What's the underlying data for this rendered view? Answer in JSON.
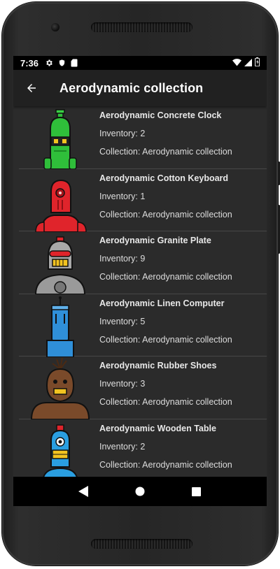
{
  "status_bar": {
    "time": "7:36",
    "icons": [
      "settings-icon",
      "shield-icon",
      "sd-card-icon"
    ],
    "right_icons": [
      "wifi-icon",
      "signal-icon",
      "battery-icon"
    ]
  },
  "app_bar": {
    "title": "Aerodynamic collection",
    "back_icon": "arrow-back-icon"
  },
  "items": [
    {
      "name": "Aerodynamic Concrete Clock",
      "inventory": "Inventory: 2",
      "collection": "Collection: Aerodynamic collection",
      "robot": "green robot",
      "color": "#2fbf3a"
    },
    {
      "name": "Aerodynamic Cotton Keyboard",
      "inventory": "Inventory: 1",
      "collection": "Collection: Aerodynamic collection",
      "robot": "red robot",
      "color": "#e0242b"
    },
    {
      "name": "Aerodynamic Granite Plate",
      "inventory": "Inventory: 9",
      "collection": "Collection: Aerodynamic collection",
      "robot": "grey robot",
      "color": "#9a9a9a"
    },
    {
      "name": "Aerodynamic Linen Computer",
      "inventory": "Inventory: 5",
      "collection": "Collection: Aerodynamic collection",
      "robot": "blue robot",
      "color": "#2f8fd8"
    },
    {
      "name": "Aerodynamic Rubber Shoes",
      "inventory": "Inventory: 3",
      "collection": "Collection: Aerodynamic collection",
      "robot": "brown robot",
      "color": "#7a4a2a"
    },
    {
      "name": "Aerodynamic Wooden Table",
      "inventory": "Inventory: 2",
      "collection": "Collection: Aerodynamic collection",
      "robot": "blue robot",
      "color": "#2a9ee0"
    }
  ],
  "nav_bar": {
    "back": "nav-back-icon",
    "home": "nav-home-icon",
    "recents": "nav-recents-icon"
  }
}
